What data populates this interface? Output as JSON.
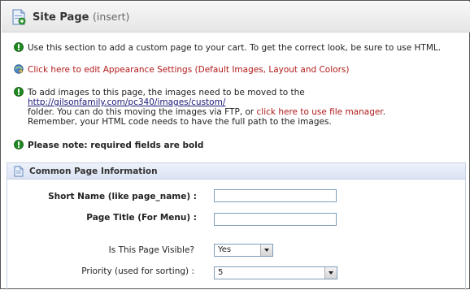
{
  "header": {
    "title": "Site Page",
    "subtitle": "(insert)"
  },
  "messages": {
    "intro": "Use this section to add a custom page to your cart. To get the correct look, be sure to use HTML.",
    "appearance_link": "Click here to edit Appearance Settings (Default Images, Layout and Colors)",
    "images_line1": "To add images to this page, the images need to be moved to the",
    "images_url": "http://gilsonfamily.com/pc340/images/custom/",
    "images_line3_pre": "folder. You can do this moving the images via FTP, or ",
    "file_manager_link": "click here to use file manager",
    "images_line3_post": ".",
    "images_line4": "Remember, your HTML code needs to have the full path to the images.",
    "note": "Please note: required fields are bold"
  },
  "section": {
    "title": "Common Page Information"
  },
  "form": {
    "short_name_label": "Short Name (like page_name) :",
    "short_name_value": "",
    "page_title_label": "Page Title (For Menu) :",
    "page_title_value": "",
    "visible_label": "Is This Page Visible?",
    "visible_value": "Yes",
    "priority_label": "Priority (used for sorting) :",
    "priority_value": "5"
  },
  "colors": {
    "link": "#b01a1a",
    "url": "#1a1a7a",
    "info_green": "#1f8a1f",
    "section_bar": "#dbe3f3"
  },
  "icons": [
    "page-icon",
    "info-icon",
    "appearance-icon",
    "section-page-icon",
    "dropdown-arrow-icon"
  ]
}
